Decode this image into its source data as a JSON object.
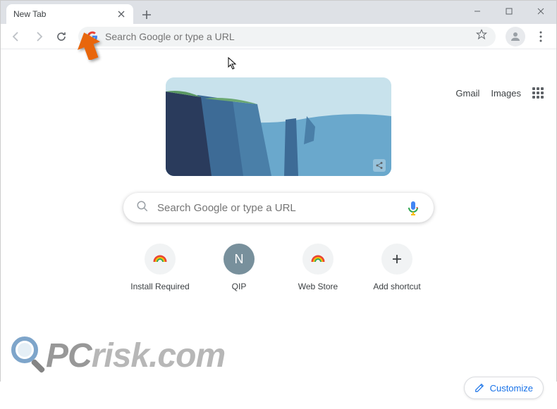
{
  "tab": {
    "title": "New Tab"
  },
  "omnibox": {
    "placeholder": "Search Google or type a URL"
  },
  "top_links": {
    "gmail": "Gmail",
    "images": "Images"
  },
  "search": {
    "placeholder": "Search Google or type a URL"
  },
  "shortcuts": [
    {
      "label": "Install Required",
      "icon": "rainbow"
    },
    {
      "label": "QIP",
      "icon": "letter-n"
    },
    {
      "label": "Web Store",
      "icon": "rainbow"
    },
    {
      "label": "Add shortcut",
      "icon": "plus"
    }
  ],
  "customize": {
    "label": "Customize"
  },
  "watermark": {
    "text_prefix": "PC",
    "text_suffix": "risk.com"
  }
}
